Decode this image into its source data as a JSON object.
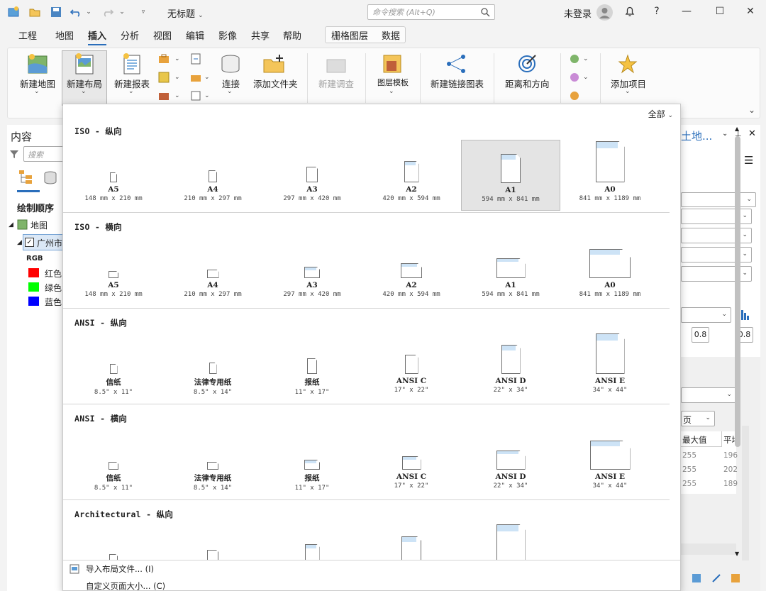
{
  "app": {
    "title": "无标题",
    "search_placeholder": "命令搜索 (Alt+Q)",
    "login": "未登录",
    "help": "?"
  },
  "menu": [
    "工程",
    "地图",
    "插入",
    "分析",
    "视图",
    "编辑",
    "影像",
    "共享",
    "帮助"
  ],
  "context_tabs": [
    "栅格图层",
    "数据"
  ],
  "ribbon": {
    "new_map": "新建地图",
    "new_layout": "新建布局",
    "new_report": "新建报表",
    "connect": "连接",
    "add_folder": "添加文件夹",
    "new_survey": "新建调查",
    "layer_template": "图层模板",
    "new_link_chart": "新建链接图表",
    "distance_direction": "距离和方向",
    "add_item": "添加项目"
  },
  "left": {
    "title": "内容",
    "search": "搜索",
    "draw_order": "绘制顺序",
    "map": "地图",
    "layer": "广州市",
    "rgb": "RGB",
    "red": "红色",
    "green": "绿色",
    "blue": "蓝色"
  },
  "right": {
    "title": "土地...",
    "v1": "0.8",
    "v2": "0.8",
    "max": "最大值",
    "avg": "平均",
    "page": "页",
    "rows": [
      {
        "max": "255",
        "avg": "196"
      },
      {
        "max": "255",
        "avg": "202"
      },
      {
        "max": "255",
        "avg": "189"
      }
    ]
  },
  "dropdown": {
    "filter": "全部",
    "sections": [
      {
        "title": "ISO - 纵向",
        "items": [
          {
            "name": "A5",
            "size": "148 mm x 210 mm"
          },
          {
            "name": "A4",
            "size": "210 mm x 297 mm"
          },
          {
            "name": "A3",
            "size": "297 mm x 420 mm"
          },
          {
            "name": "A2",
            "size": "420 mm x 594 mm"
          },
          {
            "name": "A1",
            "size": "594 mm x 841 mm"
          },
          {
            "name": "A0",
            "size": "841 mm x 1189 mm"
          }
        ]
      },
      {
        "title": "ISO - 横向",
        "items": [
          {
            "name": "A5",
            "size": "148 mm x 210 mm"
          },
          {
            "name": "A4",
            "size": "210 mm x 297 mm"
          },
          {
            "name": "A3",
            "size": "297 mm x 420 mm"
          },
          {
            "name": "A2",
            "size": "420 mm x 594 mm"
          },
          {
            "name": "A1",
            "size": "594 mm x 841 mm"
          },
          {
            "name": "A0",
            "size": "841 mm x 1189 mm"
          }
        ]
      },
      {
        "title": "ANSI - 纵向",
        "items": [
          {
            "name": "信纸",
            "size": "8.5\" x 11\""
          },
          {
            "name": "法律专用纸",
            "size": "8.5\" x 14\""
          },
          {
            "name": "报纸",
            "size": "11\" x 17\""
          },
          {
            "name": "ANSI C",
            "size": "17\" x 22\""
          },
          {
            "name": "ANSI D",
            "size": "22\" x 34\""
          },
          {
            "name": "ANSI E",
            "size": "34\" x 44\""
          }
        ]
      },
      {
        "title": "ANSI - 横向",
        "items": [
          {
            "name": "信纸",
            "size": "8.5\" x 11\""
          },
          {
            "name": "法律专用纸",
            "size": "8.5\" x 14\""
          },
          {
            "name": "报纸",
            "size": "11\" x 17\""
          },
          {
            "name": "ANSI C",
            "size": "17\" x 22\""
          },
          {
            "name": "ANSI D",
            "size": "22\" x 34\""
          },
          {
            "name": "ANSI E",
            "size": "34\" x 44\""
          }
        ]
      },
      {
        "title": "Architectural - 纵向",
        "items": [
          {
            "name": "",
            "size": ""
          },
          {
            "name": "",
            "size": ""
          },
          {
            "name": "",
            "size": ""
          },
          {
            "name": "",
            "size": ""
          },
          {
            "name": "",
            "size": ""
          }
        ]
      }
    ],
    "import_layout": "导入布局文件... (I)",
    "custom_size": "自定义页面大小... (C)"
  },
  "colors": {
    "accent": "#2a6ebb",
    "red": "#ff0000",
    "green": "#00ff00",
    "blue": "#0000ff",
    "band": "#cde3f6"
  }
}
